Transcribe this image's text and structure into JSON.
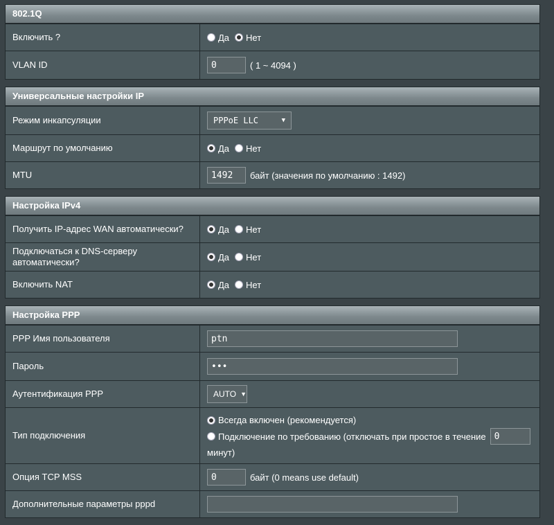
{
  "sec8021q": {
    "title": "802.1Q",
    "enable_label": "Включить ?",
    "enable_yes": "Да",
    "enable_no": "Нет",
    "vlan_label": "VLAN ID",
    "vlan_value": "0",
    "vlan_range": "( 1 ~ 4094 )"
  },
  "ip_settings": {
    "title": "Универсальные настройки IP",
    "encap_label": "Режим инкапсуляции",
    "encap_value": "PPPoE LLC",
    "route_label": "Маршрут по умолчанию",
    "route_yes": "Да",
    "route_no": "Нет",
    "mtu_label": "MTU",
    "mtu_value": "1492",
    "mtu_hint": "байт (значения по умолчанию : 1492)"
  },
  "ipv4": {
    "title": "Настройка IPv4",
    "wan_label": "Получить IP-адрес WAN автоматически?",
    "wan_yes": "Да",
    "wan_no": "Нет",
    "dns_label": "Подключаться к DNS-серверу автоматически?",
    "dns_yes": "Да",
    "dns_no": "Нет",
    "nat_label": "Включить NAT",
    "nat_yes": "Да",
    "nat_no": "Нет"
  },
  "ppp": {
    "title": "Настройка PPP",
    "user_label": "PPP Имя пользователя",
    "user_value": "ptn",
    "pass_label": "Пароль",
    "pass_value": "•••",
    "auth_label": "Аутентификация PPP",
    "auth_value": "AUTO",
    "conn_label": "Тип подключения",
    "conn_always": "Всегда включен (рекомендуется)",
    "conn_demand": "Подключение по требованию (отключать при простое в течение",
    "conn_idle_value": "0",
    "conn_minutes": "минут)",
    "mss_label": "Опция TCP MSS",
    "mss_value": "0",
    "mss_hint": "байт (0 means use default)",
    "pppd_label": "Дополнительные параметры pppd",
    "pppd_value": ""
  }
}
